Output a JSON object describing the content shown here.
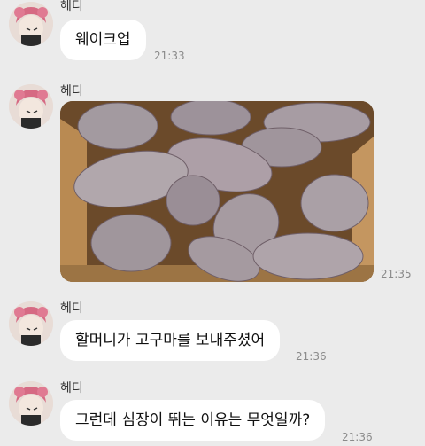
{
  "messages": [
    {
      "sender": "헤디",
      "type": "text",
      "text": "웨이크업",
      "time": "21:33"
    },
    {
      "sender": "헤디",
      "type": "image",
      "image": "photo-of-sweet-potatoes-in-box",
      "time": "21:35"
    },
    {
      "sender": "헤디",
      "type": "text",
      "text": "할머니가 고구마를 보내주셨어",
      "time": "21:36"
    },
    {
      "sender": "헤디",
      "type": "text",
      "text": "그런데 심장이 뛰는 이유는 무엇일까?",
      "time": "21:36"
    }
  ],
  "colors": {
    "background": "#ebebeb",
    "bubble": "#ffffff",
    "time_text": "#8a8a8a"
  }
}
